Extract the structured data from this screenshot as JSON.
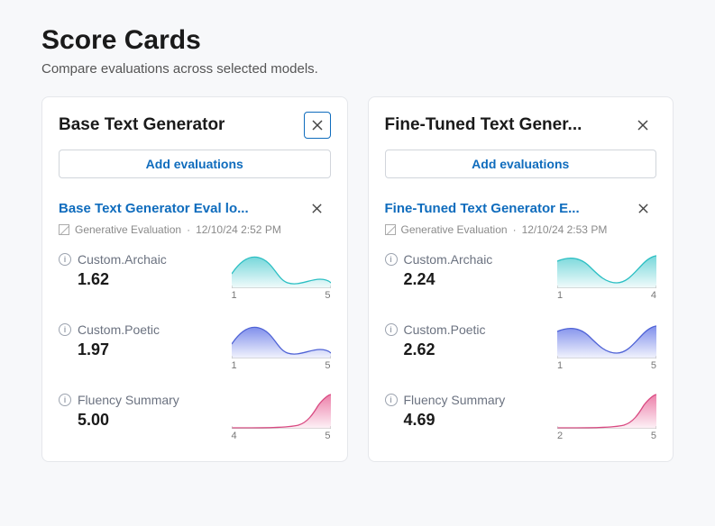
{
  "heading": {
    "title": "Score Cards",
    "subtitle": "Compare evaluations across selected models."
  },
  "cards": [
    {
      "title": "Base Text Generator",
      "close_outlined": true,
      "add_btn_label": "Add evaluations",
      "eval": {
        "link_text": "Base Text Generator Eval lo...",
        "type": "Generative Evaluation",
        "timestamp": "12/10/24 2:52 PM"
      },
      "metrics": [
        {
          "name": "Custom.Archaic",
          "value": "1.62",
          "axis_min": "1",
          "axis_max": "5",
          "color": "teal",
          "shape": "A"
        },
        {
          "name": "Custom.Poetic",
          "value": "1.97",
          "axis_min": "1",
          "axis_max": "5",
          "color": "blue",
          "shape": "A"
        },
        {
          "name": "Fluency Summary",
          "value": "5.00",
          "axis_min": "4",
          "axis_max": "5",
          "color": "pink",
          "shape": "R"
        }
      ]
    },
    {
      "title": "Fine-Tuned Text Gener...",
      "close_outlined": false,
      "add_btn_label": "Add evaluations",
      "eval": {
        "link_text": "Fine-Tuned Text Generator E...",
        "type": "Generative Evaluation",
        "timestamp": "12/10/24 2:53 PM"
      },
      "metrics": [
        {
          "name": "Custom.Archaic",
          "value": "2.24",
          "axis_min": "1",
          "axis_max": "4",
          "color": "teal",
          "shape": "B"
        },
        {
          "name": "Custom.Poetic",
          "value": "2.62",
          "axis_min": "1",
          "axis_max": "5",
          "color": "blue",
          "shape": "B"
        },
        {
          "name": "Fluency Summary",
          "value": "4.69",
          "axis_min": "2",
          "axis_max": "5",
          "color": "pink",
          "shape": "R"
        }
      ]
    }
  ],
  "chart_data": [
    {
      "card": 0,
      "metric": "Custom.Archaic",
      "type": "area",
      "x_range": [
        1,
        5
      ],
      "shape": "left-peak-decay"
    },
    {
      "card": 0,
      "metric": "Custom.Poetic",
      "type": "area",
      "x_range": [
        1,
        5
      ],
      "shape": "left-peak-decay"
    },
    {
      "card": 0,
      "metric": "Fluency Summary",
      "type": "area",
      "x_range": [
        4,
        5
      ],
      "shape": "right-peak"
    },
    {
      "card": 1,
      "metric": "Custom.Archaic",
      "type": "area",
      "x_range": [
        1,
        4
      ],
      "shape": "bimodal"
    },
    {
      "card": 1,
      "metric": "Custom.Poetic",
      "type": "area",
      "x_range": [
        1,
        5
      ],
      "shape": "bimodal"
    },
    {
      "card": 1,
      "metric": "Fluency Summary",
      "type": "area",
      "x_range": [
        2,
        5
      ],
      "shape": "right-peak"
    }
  ]
}
